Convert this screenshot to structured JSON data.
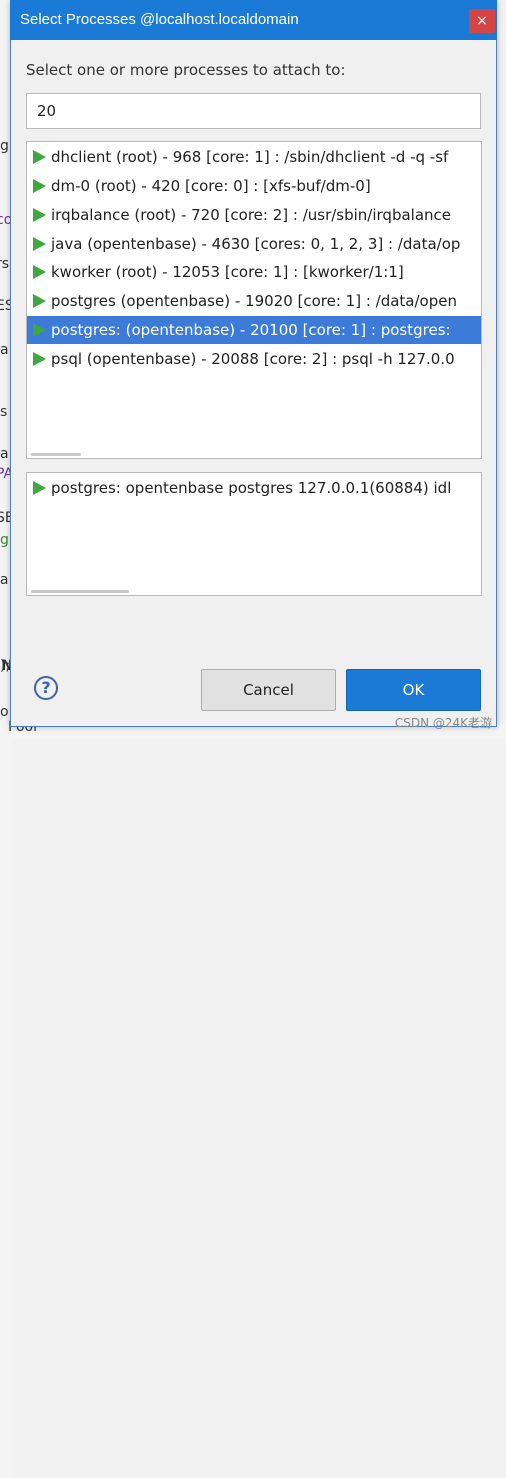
{
  "dialog": {
    "title": "Select Processes @localhost.localdomain",
    "close_label": "×",
    "prompt": "Select one or more processes to attach to:",
    "filter_value": "20",
    "processes": [
      {
        "label": "dhclient (root) - 968 [core: 1] : /sbin/dhclient -d -q -sf",
        "selected": false
      },
      {
        "label": "dm-0 (root) - 420 [core: 0] : [xfs-buf/dm-0]",
        "selected": false
      },
      {
        "label": "irqbalance (root) - 720 [core: 2] : /usr/sbin/irqbalance",
        "selected": false
      },
      {
        "label": "java (opentenbase) - 4630 [cores: 0, 1, 2, 3] : /data/op",
        "selected": false
      },
      {
        "label": "kworker (root) - 12053 [core: 1] : [kworker/1:1]",
        "selected": false
      },
      {
        "label": "postgres (opentenbase) - 19020 [core: 1] : /data/open",
        "selected": false
      },
      {
        "label": "postgres: (opentenbase) - 20100 [core: 1] : postgres:",
        "selected": true
      },
      {
        "label": "psql (opentenbase) - 20088 [core: 2] : psql -h 127.0.0",
        "selected": false
      }
    ],
    "detail": "postgres: opentenbase postgres 127.0.0.1(60884) idl",
    "help_label": "?",
    "cancel_label": "Cancel",
    "ok_label": "OK"
  },
  "background": {
    "fragments": [
      "g",
      "co",
      "rs",
      "ES",
      "a",
      "s",
      "a",
      "PA",
      "SE",
      "g",
      "la",
      "IN",
      "o",
      "Pool"
    ],
    "right_fragments": [
      ");"
    ]
  },
  "watermark": "CSDN @24K老游",
  "colors": {
    "accent": "#1b7ad6",
    "selection": "#3d7bd8",
    "play_icon": "#3ea83e",
    "close": "#d64545"
  }
}
